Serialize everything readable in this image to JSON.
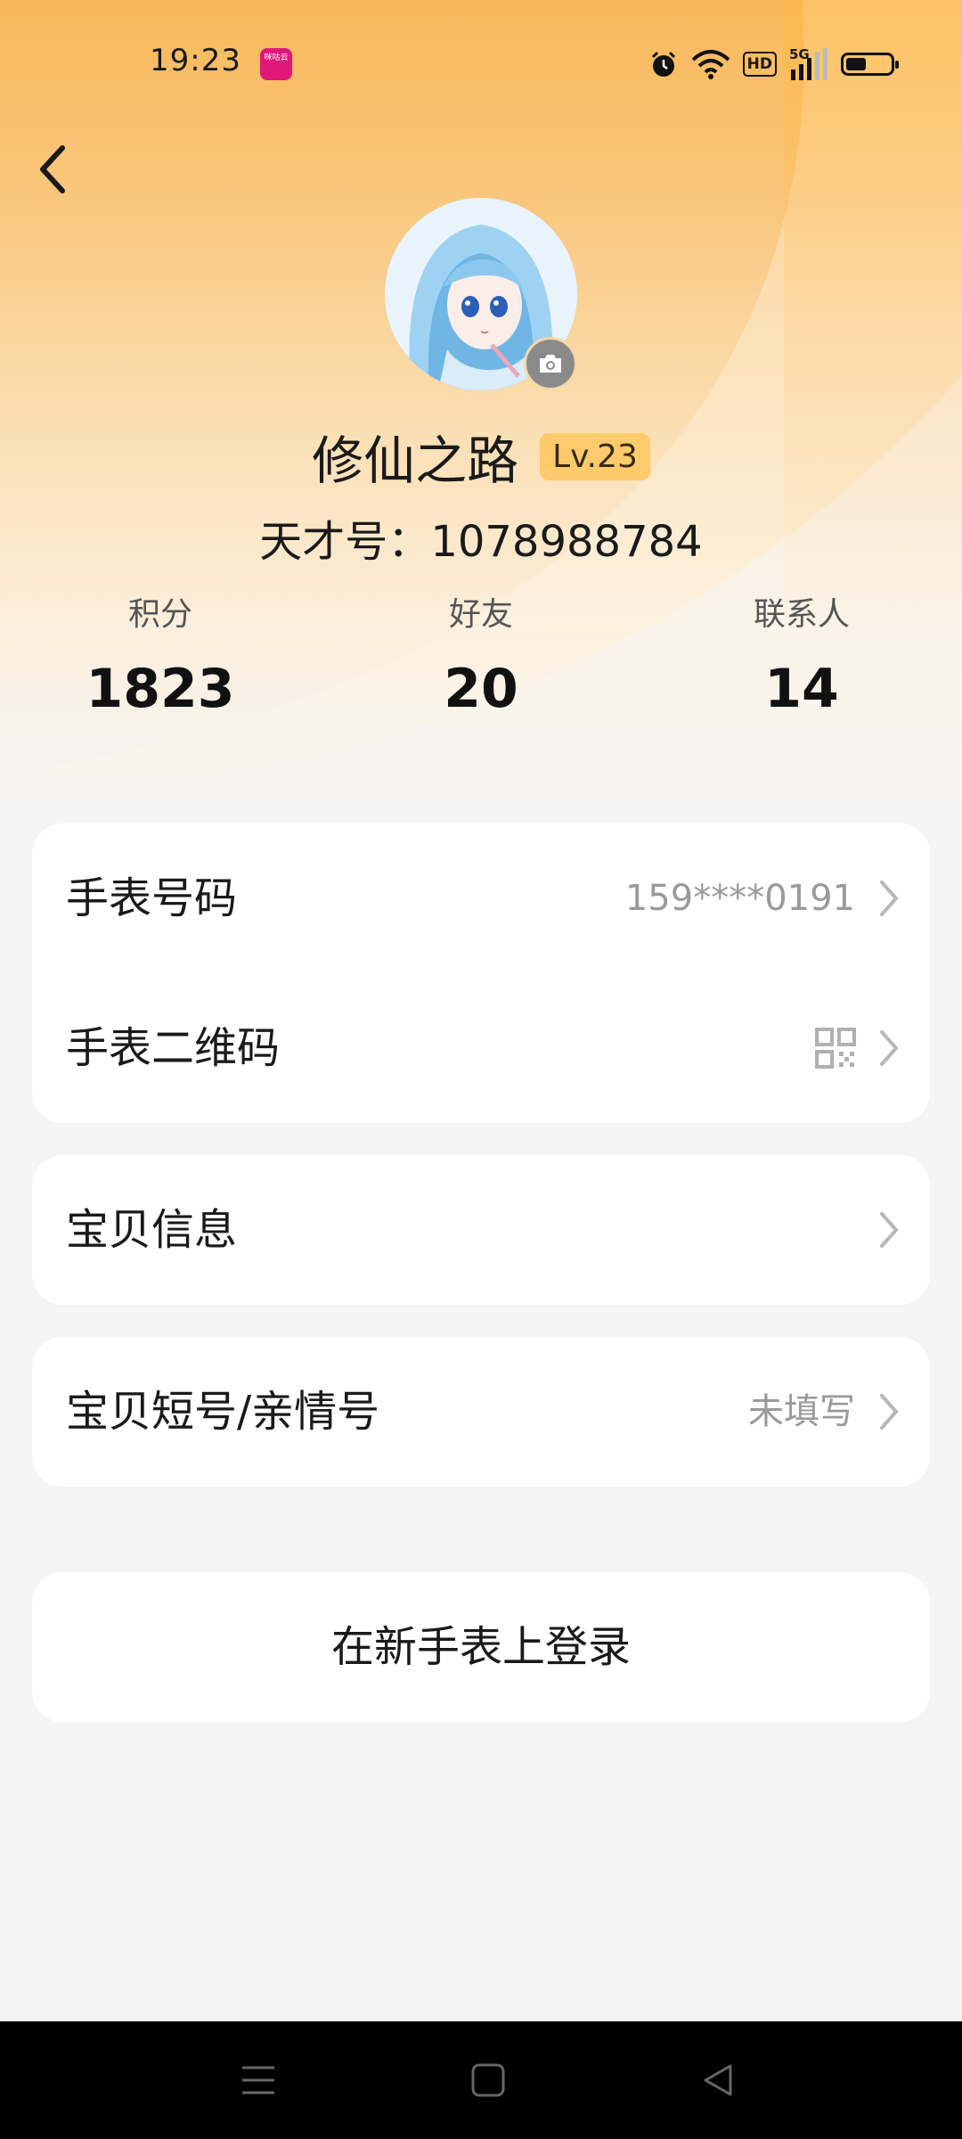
{
  "status_bar": {
    "time": "19:23",
    "app_icon_text": "咪咕云",
    "icons": [
      "alarm-icon",
      "wifi-icon",
      "hd-icon",
      "5g-signal-icon",
      "battery-icon"
    ],
    "hd_label": "HD",
    "network_label": "5G",
    "battery_level": 0.45
  },
  "profile": {
    "name": "修仙之路",
    "level": "Lv.23",
    "id_label": "天才号：",
    "id_value": "1078988784"
  },
  "stats": [
    {
      "label": "积分",
      "value": "1823"
    },
    {
      "label": "好友",
      "value": "20"
    },
    {
      "label": "联系人",
      "value": "14"
    }
  ],
  "settings": {
    "watch_number": {
      "label": "手表号码",
      "value": "159****0191"
    },
    "watch_qr": {
      "label": "手表二维码"
    },
    "baby_info": {
      "label": "宝贝信息"
    },
    "short_number": {
      "label": "宝贝短号/亲情号",
      "value": "未填写"
    }
  },
  "login_button": "在新手表上登录",
  "colors": {
    "accent": "#f7b85a",
    "level_badge": "#ffca6b",
    "card": "#ffffff",
    "background": "#f4f4f4"
  }
}
